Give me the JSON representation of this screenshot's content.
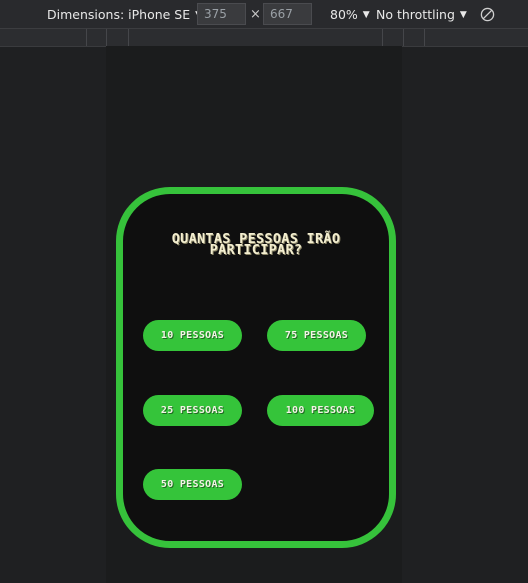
{
  "toolbar": {
    "dimensions_label": "Dimensions: iPhone SE",
    "width_value": "375",
    "times": "×",
    "height_value": "667",
    "zoom": "80%",
    "throttling": "No throttling",
    "rotate_icon": "rotate-icon"
  },
  "quiz": {
    "question": "QUANTAS PESSOAS IRÃO PARTICIPAR?",
    "options": [
      "10 PESSOAS",
      "75 PESSOAS",
      "25 PESSOAS",
      "100 PESSOAS",
      "50 PESSOAS"
    ]
  },
  "colors": {
    "accent": "#36c23b",
    "card_bg": "#0f0f0f",
    "page_bg": "#1f2022"
  }
}
